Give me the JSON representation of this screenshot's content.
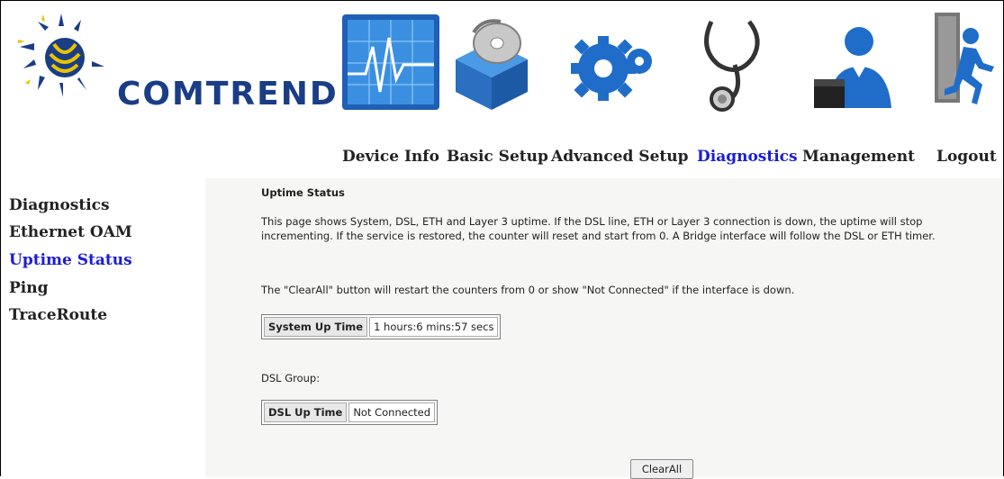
{
  "header": {
    "brand": "COMTREND"
  },
  "nav": {
    "items": [
      {
        "label": "Device Info",
        "icon": "heartbeat-monitor-icon"
      },
      {
        "label": "Basic Setup",
        "icon": "disc-box-icon"
      },
      {
        "label": "Advanced Setup",
        "icon": "gears-icon"
      },
      {
        "label": "Diagnostics",
        "icon": "stethoscope-icon"
      },
      {
        "label": "Management",
        "icon": "user-icon"
      },
      {
        "label": "Logout",
        "icon": "exit-door-icon"
      }
    ],
    "active": "Diagnostics"
  },
  "sidebar": {
    "items": [
      {
        "label": "Diagnostics"
      },
      {
        "label": "Ethernet OAM"
      },
      {
        "label": "Uptime Status"
      },
      {
        "label": "Ping"
      },
      {
        "label": "TraceRoute"
      }
    ],
    "active": "Uptime Status"
  },
  "main": {
    "title": "Uptime Status",
    "description": "This page shows System, DSL, ETH and Layer 3 uptime. If the DSL line, ETH or Layer 3 connection is down, the uptime will stop incrementing. If the service is restored, the counter will reset and start from 0. A Bridge interface will follow the DSL or ETH timer.",
    "note": "The \"ClearAll\" button will restart the counters from 0 or show \"Not Connected\" if the interface is down.",
    "system": {
      "label": "System Up Time",
      "value": "1 hours:6 mins:57 secs"
    },
    "dsl_group_label": "DSL Group:",
    "dsl": {
      "label": "DSL Up Time",
      "value": "Not Connected"
    },
    "clear_button": "ClearAll"
  },
  "colors": {
    "active_link": "#1c1cd6",
    "brand_blue": "#1a3d86",
    "content_bg": "#f6f6f4"
  }
}
